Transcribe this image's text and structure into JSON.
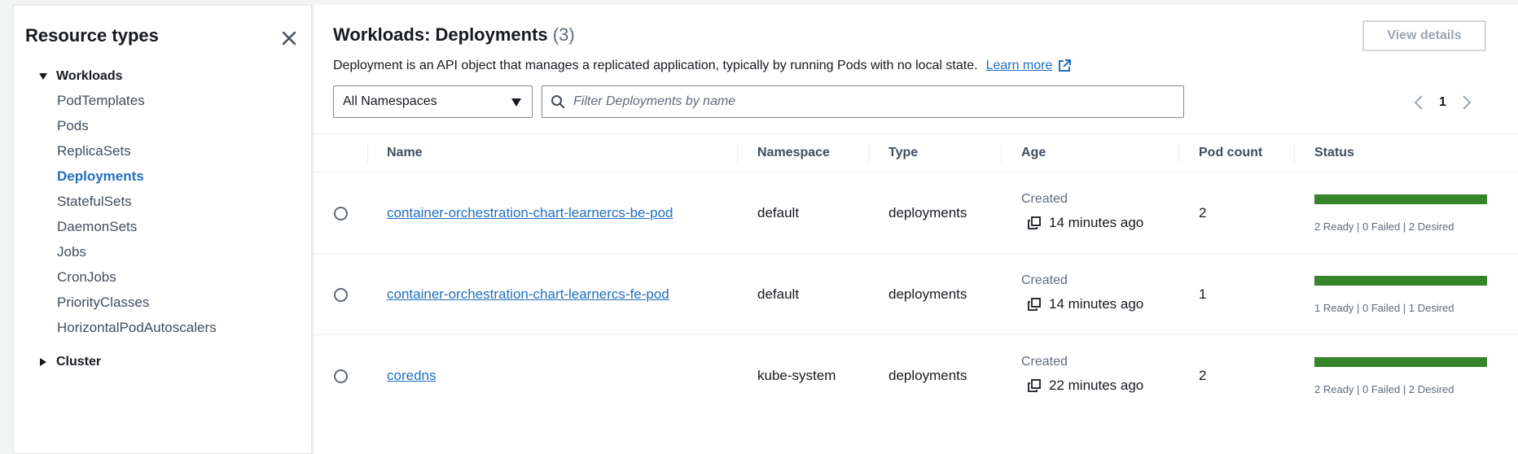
{
  "sidebar": {
    "title": "Resource types",
    "workloads_label": "Workloads",
    "items": [
      "PodTemplates",
      "Pods",
      "ReplicaSets",
      "Deployments",
      "StatefulSets",
      "DaemonSets",
      "Jobs",
      "CronJobs",
      "PriorityClasses",
      "HorizontalPodAutoscalers"
    ],
    "active_item": "Deployments",
    "cluster_label": "Cluster"
  },
  "header": {
    "title": "Workloads: Deployments",
    "count": "(3)",
    "description": "Deployment is an API object that manages a replicated application, typically by running Pods with no local state.",
    "learn_more": "Learn more",
    "view_details": "View details"
  },
  "filters": {
    "namespace_selected": "All Namespaces",
    "search_placeholder": "Filter Deployments by name",
    "search_value": ""
  },
  "pagination": {
    "current_page": "1"
  },
  "table": {
    "columns": [
      "Name",
      "Namespace",
      "Type",
      "Age",
      "Pod count",
      "Status"
    ],
    "rows": [
      {
        "name": "container-orchestration-chart-learnercs-be-pod",
        "namespace": "default",
        "type": "deployments",
        "age_label": "Created",
        "age_value": "14 minutes ago",
        "pod_count": "2",
        "status_text": "2 Ready | 0 Failed | 2 Desired",
        "ready_fraction": 1.0
      },
      {
        "name": "container-orchestration-chart-learnercs-fe-pod",
        "namespace": "default",
        "type": "deployments",
        "age_label": "Created",
        "age_value": "14 minutes ago",
        "pod_count": "1",
        "status_text": "1 Ready | 0 Failed | 1 Desired",
        "ready_fraction": 1.0
      },
      {
        "name": "coredns",
        "namespace": "kube-system",
        "type": "deployments",
        "age_label": "Created",
        "age_value": "22 minutes ago",
        "pod_count": "2",
        "status_text": "2 Ready | 0 Failed | 2 Desired",
        "ready_fraction": 1.0
      }
    ]
  },
  "colors": {
    "link": "#1f6fbf",
    "status_ready": "#37852b"
  }
}
